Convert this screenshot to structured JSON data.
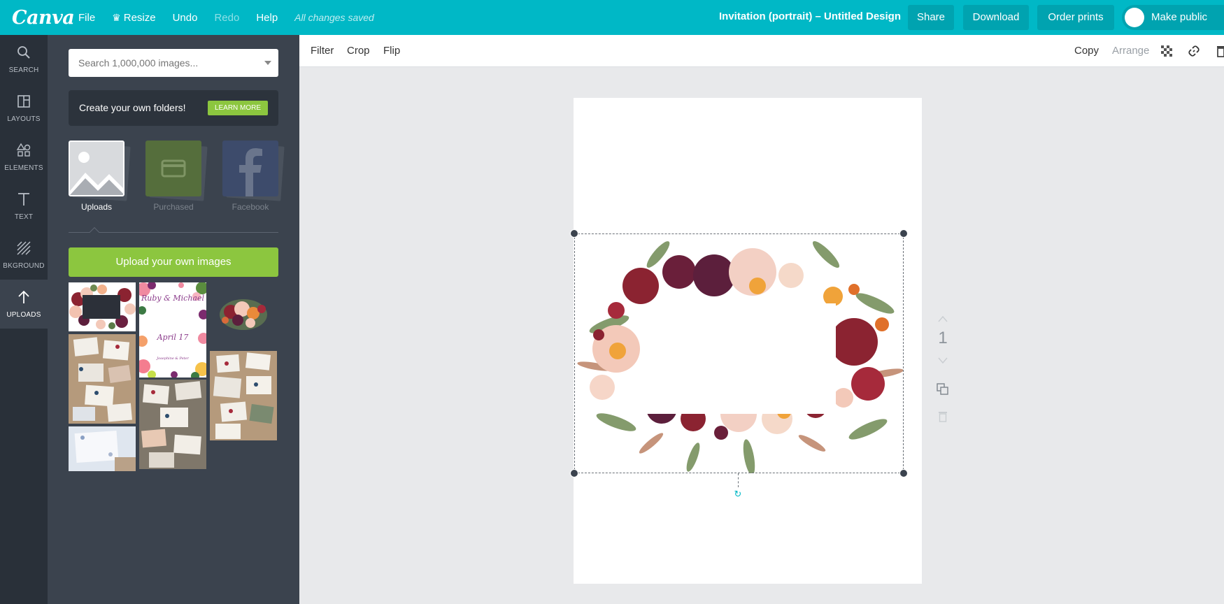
{
  "topbar": {
    "logo": "Canva",
    "menu": [
      {
        "label": "File"
      },
      {
        "label": "Resize"
      },
      {
        "label": "Undo"
      },
      {
        "label": "Redo"
      },
      {
        "label": "Help"
      }
    ],
    "status": "All changes saved",
    "doc_title": "Invitation (portrait) – Untitled Design",
    "share": "Share",
    "download": "Download",
    "order_prints": "Order prints",
    "make_public": "Make public"
  },
  "rail": [
    {
      "label": "SEARCH",
      "icon": "search-icon"
    },
    {
      "label": "LAYOUTS",
      "icon": "layouts-icon"
    },
    {
      "label": "ELEMENTS",
      "icon": "elements-icon"
    },
    {
      "label": "TEXT",
      "icon": "text-icon"
    },
    {
      "label": "BKGROUND",
      "icon": "background-icon"
    },
    {
      "label": "UPLOADS",
      "icon": "upload-arrow-icon",
      "active": true
    }
  ],
  "panel": {
    "search_placeholder": "Search 1,000,000 images...",
    "folder_text": "Create your own folders!",
    "learn_more": "LEARN MORE",
    "sources": [
      {
        "label": "Uploads",
        "active": true
      },
      {
        "label": "Purchased",
        "active": false
      },
      {
        "label": "Facebook",
        "active": false
      }
    ],
    "upload_button": "Upload your own images",
    "invite_card": {
      "names": "Ruby & Michael",
      "date": "April 17",
      "footer": "Josephine & Peter"
    }
  },
  "context_toolbar": {
    "filter": "Filter",
    "crop": "Crop",
    "flip": "Flip",
    "copy": "Copy",
    "arrange": "Arrange"
  },
  "canvas": {
    "page_number": "1"
  },
  "colors": {
    "brand": "#00b8c6",
    "rail_bg": "#293039",
    "panel_bg": "#3b434e",
    "green": "#8cc63f"
  }
}
